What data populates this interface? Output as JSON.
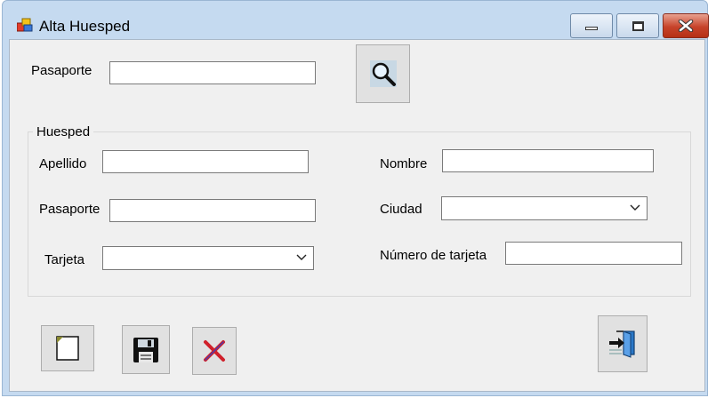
{
  "window": {
    "title": "Alta Huesped",
    "icon": "app-form-icon",
    "controls": [
      "minimize-icon",
      "maximize-icon",
      "close-icon"
    ]
  },
  "search": {
    "label": "Pasaporte",
    "value": "",
    "button_icon": "magnifier-icon"
  },
  "huesped": {
    "group_title": "Huesped",
    "apellido_label": "Apellido",
    "apellido_value": "",
    "pasaporte_label": "Pasaporte",
    "pasaporte_value": "",
    "tarjeta_label": "Tarjeta",
    "tarjeta_value": "",
    "nombre_label": "Nombre",
    "nombre_value": "",
    "ciudad_label": "Ciudad",
    "ciudad_value": "",
    "numero_tarjeta_label": "Número de tarjeta",
    "numero_tarjeta_value": ""
  },
  "actions": {
    "new_icon": "new-document-icon",
    "save_icon": "floppy-disk-icon",
    "cancel_icon": "red-x-icon",
    "exit_icon": "exit-door-icon"
  },
  "colors": {
    "titlebar": "#c5daf0",
    "client_bg": "#f0f0f0",
    "close_button": "#c7432a"
  }
}
